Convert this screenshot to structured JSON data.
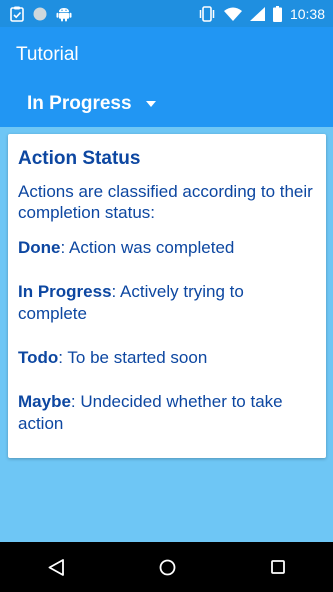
{
  "status_bar": {
    "time": "10:38",
    "left_icons": [
      "clipboard-check-icon",
      "circle-icon",
      "android-icon"
    ],
    "right_icons": [
      "vibrate-icon",
      "wifi-icon",
      "cellular-signal-icon",
      "battery-icon"
    ]
  },
  "app_bar": {
    "title": "Tutorial",
    "filter_selected": "In Progress",
    "filter_icon": "dropdown-arrow-icon"
  },
  "card": {
    "title": "Action Status",
    "intro": "Actions are classified according to their completion status:",
    "items": [
      {
        "term": "Done",
        "desc": ": Action was completed"
      },
      {
        "term": "In Progress",
        "desc": ": Actively trying to complete"
      },
      {
        "term": "Todo",
        "desc": ": To be started soon"
      },
      {
        "term": "Maybe",
        "desc": ": Undecided whether to take action"
      }
    ]
  },
  "nav_bar": {
    "icons": [
      "back-icon",
      "home-icon",
      "recents-icon"
    ]
  },
  "colors": {
    "status_bar": "#1f8fe0",
    "app_bar": "#2196f3",
    "background": "#6ec6f5",
    "card_text": "#0d47a1",
    "nav_bar": "#000000"
  }
}
